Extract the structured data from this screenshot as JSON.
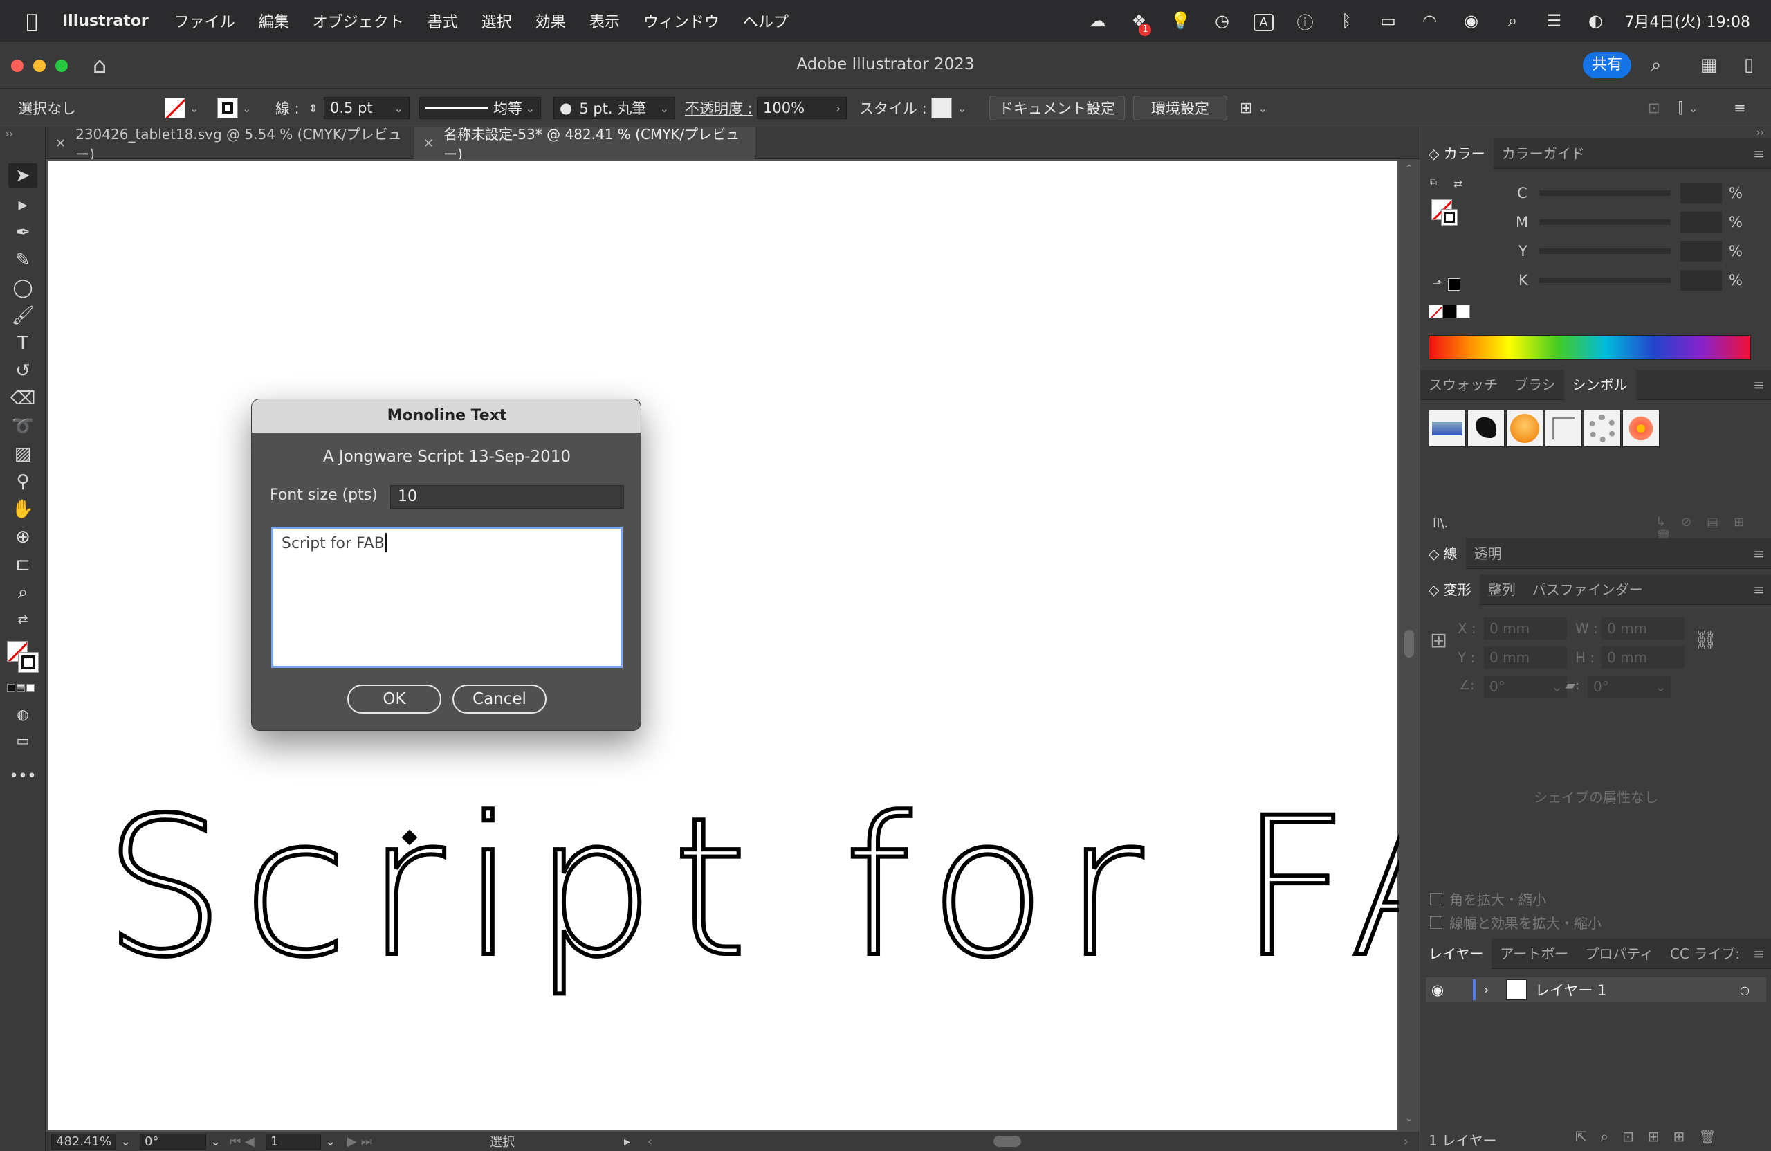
{
  "menubar": {
    "app_name": "Illustrator",
    "items": [
      "ファイル",
      "編集",
      "オブジェクト",
      "書式",
      "選択",
      "効果",
      "表示",
      "ウィンドウ",
      "ヘルプ"
    ],
    "input_indicator": "A",
    "clock": "7月4日(火) 19:08",
    "badge_count": "1"
  },
  "window": {
    "title": "Adobe Illustrator 2023",
    "share_label": "共有"
  },
  "control_bar": {
    "selection": "選択なし",
    "stroke_label": "線 :",
    "stroke_weight": "0.5 pt",
    "stroke_profile": "均等",
    "brush": "5 pt. 丸筆",
    "opacity_label": "不透明度 :",
    "opacity_value": "100%",
    "style_label": "スタイル :",
    "doc_setup_button": "ドキュメント設定",
    "preferences_button": "環境設定"
  },
  "tabs": [
    {
      "label": "230426_tablet18.svg @ 5.54 % (CMYK/プレビュー)",
      "active": false
    },
    {
      "label": "名称未設定-53* @ 482.41 % (CMYK/プレビュー)",
      "active": true
    }
  ],
  "canvas": {
    "artwork_text": "Script for FAB"
  },
  "dialog": {
    "title": "Monoline Text",
    "subtitle": "A Jongware Script 13-Sep-2010",
    "font_size_label": "Font size (pts)",
    "font_size_value": "10",
    "text_value": "Script for FAB",
    "ok_label": "OK",
    "cancel_label": "Cancel"
  },
  "status_bar": {
    "zoom": "482.41%",
    "rotation": "0°",
    "artboard_number": "1",
    "mode": "選択"
  },
  "panels": {
    "color": {
      "tabs": [
        "カラー",
        "カラーガイド"
      ],
      "channels": [
        "C",
        "M",
        "Y",
        "K"
      ],
      "unit": "%"
    },
    "swatches": {
      "tabs": [
        "スウォッチ",
        "ブラシ",
        "シンボル"
      ],
      "active_tab": "シンボル"
    },
    "stroke": {
      "tabs": [
        "線",
        "透明"
      ]
    },
    "transform": {
      "tabs": [
        "変形",
        "整列",
        "パスファインダー"
      ],
      "x_label": "X :",
      "x_value": "0 mm",
      "y_label": "Y :",
      "y_value": "0 mm",
      "w_label": "W :",
      "w_value": "0 mm",
      "h_label": "H :",
      "h_value": "0 mm",
      "angle_value": "0°",
      "shear_value": "0°",
      "no_shape_text": "シェイプの属性なし",
      "scale_corners": "角を拡大・縮小",
      "scale_strokes": "線幅と効果を拡大・縮小"
    },
    "layers": {
      "tabs": [
        "レイヤー",
        "アートボー",
        "プロパティ",
        "CC ライブ:"
      ],
      "layer_name": "レイヤー 1",
      "count_label": "1 レイヤー"
    }
  },
  "colors": {
    "accent": "#1473e6",
    "layer_color": "#4f7cff"
  }
}
